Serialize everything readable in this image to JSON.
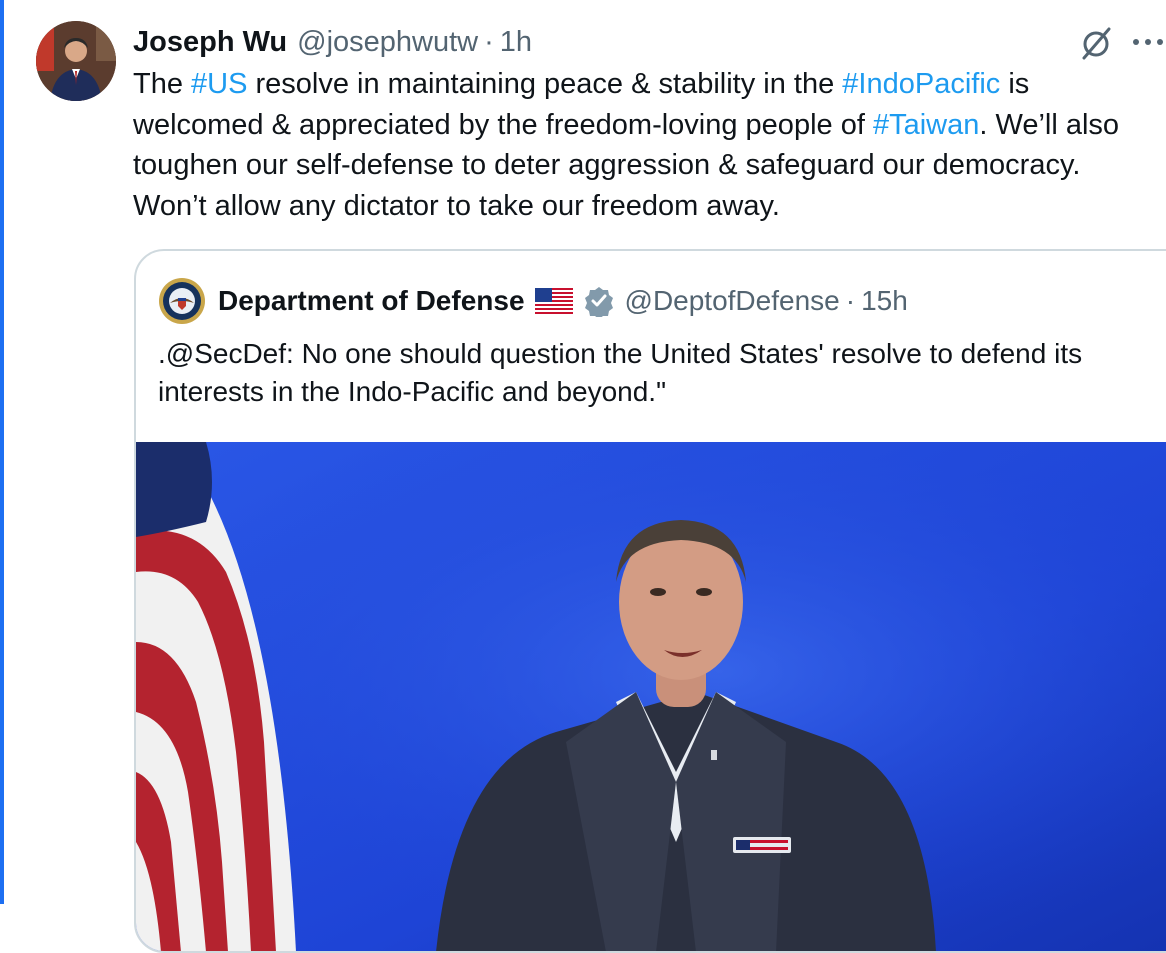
{
  "tweet": {
    "author_name": "Joseph Wu",
    "author_handle": "@josephwutw",
    "separator": "·",
    "time": "1h",
    "text": {
      "p1": "The ",
      "tag1": "#US",
      "p2": " resolve in maintaining peace & stability in the ",
      "tag2": "#IndoPacific",
      "p3": " is welcomed & appreciated by the freedom-loving people of ",
      "tag3": "#Taiwan",
      "p4": ". We’ll also toughen our self-defense to deter aggression & safeguard our democracy. Won’t allow any dictator to take our freedom away."
    },
    "hashtag_color": "#1d9bf0"
  },
  "quoted_tweet": {
    "author_name": "Department of Defense",
    "author_handle": "@DeptofDefense",
    "separator": "·",
    "time": "15h",
    "text": ".@SecDef: No one should question the United States' resolve to defend its interests in the Indo-Pacific and beyond.\""
  },
  "icons": {
    "grok": "grok-slash-circle-icon",
    "more": "more-dots-icon",
    "flag": "us-flag-icon",
    "verified": "verified-badge-icon",
    "seal": "dod-seal-icon"
  },
  "colors": {
    "accent_rail": "#1d6ff2",
    "text_primary": "#0f1419",
    "text_secondary": "#536471",
    "media_background": "#1e44d6"
  }
}
